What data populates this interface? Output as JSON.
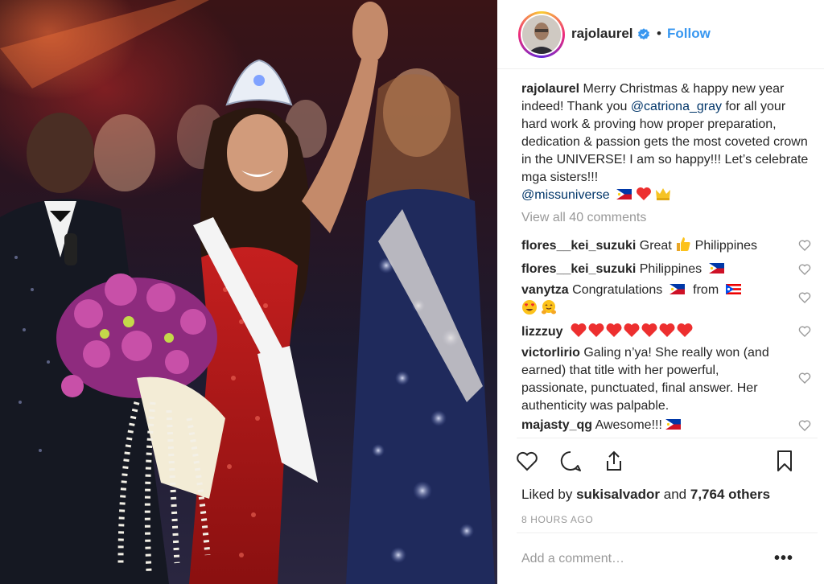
{
  "header": {
    "username": "rajolaurel",
    "separator": "•",
    "follow_label": "Follow"
  },
  "caption": {
    "username": "rajolaurel",
    "text_1": "Merry Christmas & happy new year indeed! Thank you ",
    "mention_1": "@catriona_gray",
    "text_2": " for all your hard work & proving how proper preparation, dedication & passion gets the most coveted crown in the UNIVERSE! I am so happy!!! Let’s celebrate mga sisters!!!",
    "mention_2": "@missuniverse"
  },
  "view_all": "View all 40 comments",
  "comments": [
    {
      "username": "flores__kei_suzuki",
      "text_a": "Great",
      "text_b": "Philippines"
    },
    {
      "username": "flores__kei_suzuki",
      "text": "Philippines"
    },
    {
      "username": "vanytza",
      "text_a": "Congratulations",
      "text_b": "from"
    },
    {
      "username": "lizzzuy"
    },
    {
      "username": "victorlirio",
      "text": "Galing n’ya! She really won (and earned) that title with her powerful, passionate, punctuated, final answer. Her authenticity was palpable."
    },
    {
      "username": "majasty_qg",
      "text": "Awesome!!!"
    }
  ],
  "likes": {
    "prefix": "Liked by",
    "user": "sukisalvador",
    "and": "and",
    "others": "7,764 others"
  },
  "timestamp": "8 HOURS AGO",
  "add_comment_placeholder": "Add a comment…",
  "more_label": "•••",
  "icons": [
    "verified-badge-icon",
    "heart-icon",
    "comment-icon",
    "share-icon",
    "bookmark-icon",
    "more-icon"
  ],
  "colors": {
    "link": "#3897f0",
    "mention": "#003569",
    "muted": "#999999",
    "heart": "#ed2f2f"
  }
}
